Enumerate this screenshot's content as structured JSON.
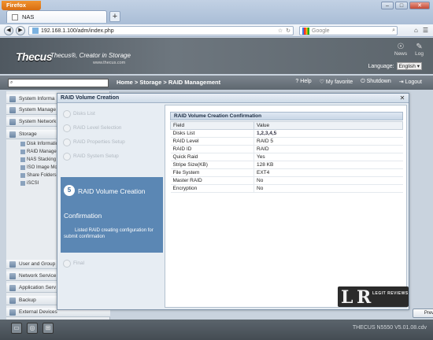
{
  "browser": {
    "menu_label": "Firefox",
    "tab_title": "NAS",
    "url": "192.168.1.100/adm/index.php",
    "search_placeholder": "Google",
    "new_tab": "+"
  },
  "banner": {
    "logo": "Thecus",
    "slogan": "Thecus®, Creator in Storage",
    "site": "www.thecus.com",
    "news": "News",
    "log": "Log",
    "language_label": "Language:",
    "language_value": "English"
  },
  "header": {
    "breadcrumb": "Home > Storage > RAID Management",
    "help": "Help",
    "favorite": "My favorite",
    "shutdown": "Shutdown",
    "logout": "Logout"
  },
  "sidebar": {
    "top_items": [
      "System Informa",
      "System Manage",
      "System Network",
      "Storage"
    ],
    "storage_sub": [
      "Disk Information",
      "RAID Management",
      "NAS Stacking",
      "ISO Image Mou",
      "Share Folders",
      "iSCSI"
    ],
    "bottom_items": [
      "User and Group",
      "Network Service",
      "Application Serv",
      "Backup",
      "External Devices"
    ]
  },
  "modal": {
    "title": "RAID Volume Creation",
    "steps": [
      "Disks List",
      "RAID Level Selection",
      "RAID Properties Setup",
      "RAID System Setup"
    ],
    "active_step_num": "5",
    "active_step_title_1": "RAID Volume Creation",
    "active_step_title_2": "Confirmation",
    "active_step_desc": "Listed RAID creating configuration for submit confirmation",
    "final_step": "Final",
    "panel_title": "RAID Volume Creation Confirmation",
    "col_field": "Field",
    "col_value": "Value",
    "rows": [
      {
        "field": "Disks List",
        "value": "1,2,3,4,5"
      },
      {
        "field": "RAID Level",
        "value": "RAID 5"
      },
      {
        "field": "RAID ID",
        "value": "RAID"
      },
      {
        "field": "Quick Raid",
        "value": "Yes"
      },
      {
        "field": "Stripe Size(KB)",
        "value": "128 KB"
      },
      {
        "field": "File System",
        "value": "EXT4"
      },
      {
        "field": "Master RAID",
        "value": "No"
      },
      {
        "field": "Encryption",
        "value": "No"
      }
    ],
    "prev_button": "Prev"
  },
  "footer": {
    "version": "THECUS N5550 V5.01.08.cdv"
  },
  "watermark": {
    "text": "LEGIT REVIEWS"
  }
}
